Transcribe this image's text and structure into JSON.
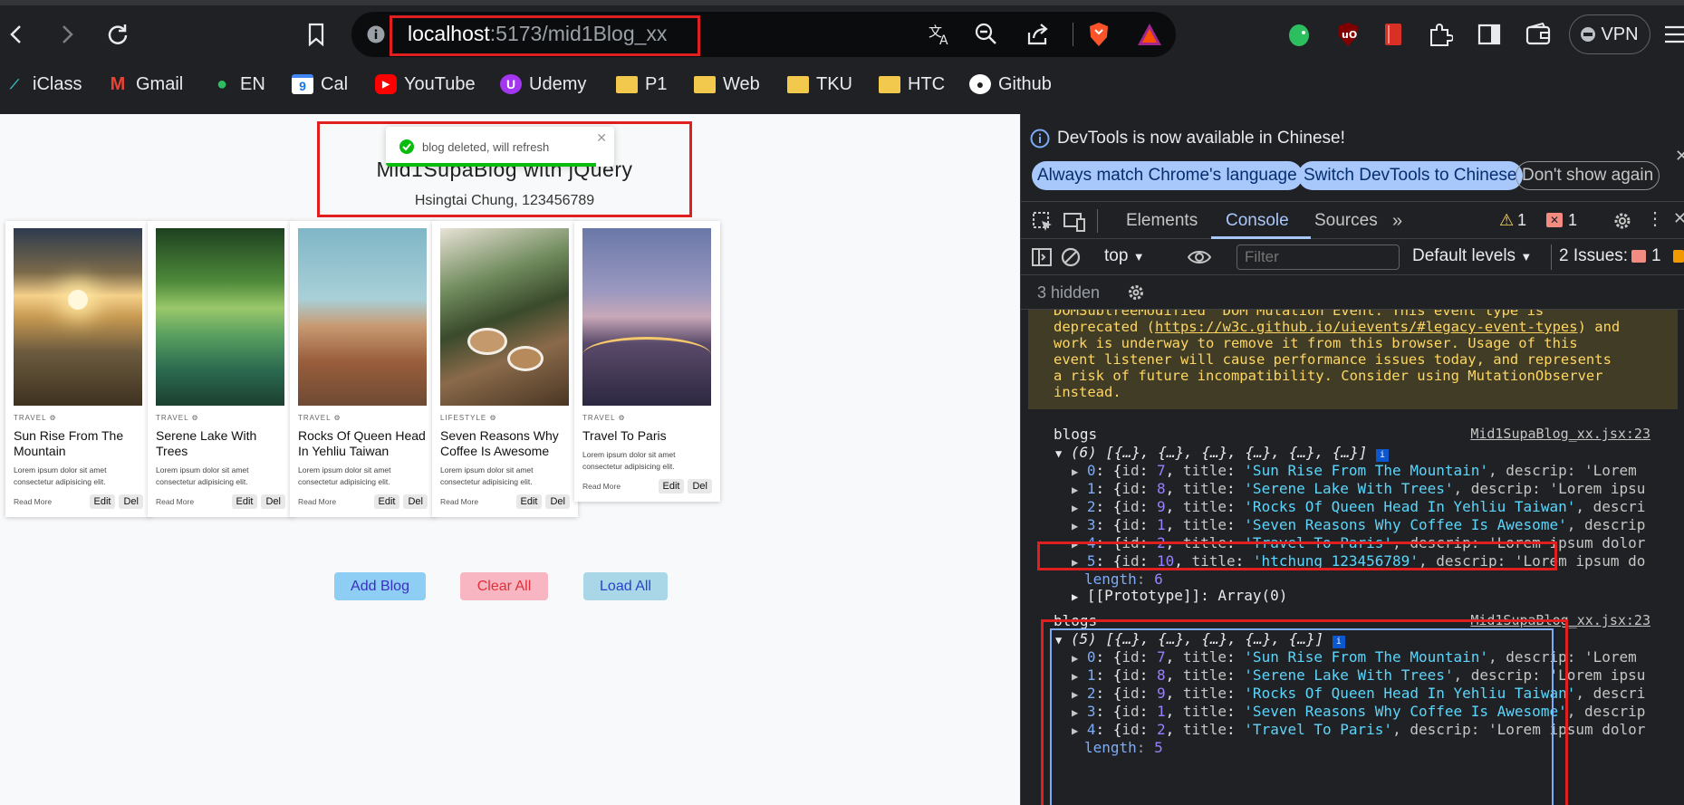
{
  "browser": {
    "url_host": "localhost",
    "url_path": ":5173/mid1Blog_xx",
    "vpn_label": "VPN",
    "bookmarks": [
      {
        "label": "iClass",
        "icon": "iclass-icon"
      },
      {
        "label": "Gmail",
        "icon": "gmail-icon"
      },
      {
        "label": "EN",
        "icon": "evernote-icon"
      },
      {
        "label": "Cal",
        "icon": "calendar-icon"
      },
      {
        "label": "YouTube",
        "icon": "youtube-icon"
      },
      {
        "label": "Udemy",
        "icon": "udemy-icon"
      },
      {
        "label": "P1",
        "icon": "folder-icon"
      },
      {
        "label": "Web",
        "icon": "folder-icon"
      },
      {
        "label": "TKU",
        "icon": "folder-icon"
      },
      {
        "label": "HTC",
        "icon": "folder-icon"
      },
      {
        "label": "Github",
        "icon": "github-icon"
      }
    ]
  },
  "app": {
    "title": "Mid1SupaBlog with jQuery",
    "subtitle": "Hsingtai Chung, 123456789",
    "toast": "blog deleted, will refresh",
    "cards": [
      {
        "category": "TRAVEL",
        "title": "Sun Rise From The Mountain",
        "desc": "Lorem ipsum dolor sit amet consectetur adipisicing elit.",
        "read_more": "Read More",
        "edit": "Edit",
        "del": "Del"
      },
      {
        "category": "TRAVEL",
        "title": "Serene Lake With Trees",
        "desc": "Lorem ipsum dolor sit amet consectetur adipisicing elit.",
        "read_more": "Read More",
        "edit": "Edit",
        "del": "Del"
      },
      {
        "category": "TRAVEL",
        "title": "Rocks Of Queen Head In Yehliu Taiwan",
        "desc": "Lorem ipsum dolor sit amet consectetur adipisicing elit.",
        "read_more": "Read More",
        "edit": "Edit",
        "del": "Del"
      },
      {
        "category": "LIFESTYLE",
        "title": "Seven Reasons Why Coffee Is Awesome",
        "desc": "Lorem ipsum dolor sit amet consectetur adipisicing elit.",
        "read_more": "Read More",
        "edit": "Edit",
        "del": "Del"
      },
      {
        "category": "TRAVEL",
        "title": "Travel To Paris",
        "desc": "Lorem ipsum dolor sit amet consectetur adipisicing elit.",
        "read_more": "Read More",
        "edit": "Edit",
        "del": "Del"
      }
    ],
    "buttons": {
      "add": "Add Blog",
      "clear": "Clear All",
      "load": "Load All"
    }
  },
  "devtools": {
    "info": "DevTools is now available in Chinese!",
    "lang_buttons": [
      "Always match Chrome's language",
      "Switch DevTools to Chinese",
      "Don't show again"
    ],
    "tabs": [
      "Elements",
      "Console",
      "Sources"
    ],
    "warn_count": "1",
    "error_count": "1",
    "context": "top",
    "filter_placeholder": "Filter",
    "levels": "Default levels",
    "issues": "2 Issues:",
    "issues_count": "1",
    "hidden": "3 hidden",
    "warning_lines": [
      "DOMSubtreeModified  DOM Mutation Event. This event type is",
      "deprecated (",
      "https://w3c.github.io/uievents/#legacy-event-types",
      ") and",
      "work is underway to remove it from this browser. Usage of this",
      "event listener will cause performance issues today, and represents",
      "a risk of future incompatibility. Consider using MutationObserver",
      "instead."
    ],
    "log_label": "blogs",
    "source": "Mid1SupaBlog_xx.jsx:23",
    "group1_header": "(6) [{…}, {…}, {…}, {…}, {…}, {…}]",
    "group2_header": "(5) [{…}, {…}, {…}, {…}, {…}]",
    "length_label": "length",
    "length6": "6",
    "length5": "5",
    "prototype": "[[Prototype]]: Array(0)",
    "group1": [
      {
        "idx": "0",
        "id": "7",
        "title": "'Sun Rise From The Mountain'",
        "tail": ", descrip: 'Lorem"
      },
      {
        "idx": "1",
        "id": "8",
        "title": "'Serene Lake With Trees'",
        "tail": ", descrip: 'Lorem ipsu"
      },
      {
        "idx": "2",
        "id": "9",
        "title": "'Rocks Of Queen Head In Yehliu Taiwan'",
        "tail": ", descri"
      },
      {
        "idx": "3",
        "id": "1",
        "title": "'Seven Reasons Why Coffee Is Awesome'",
        "tail": ", descrip"
      },
      {
        "idx": "4",
        "id": "2",
        "title": "'Travel To Paris'",
        "tail": ", descrip: 'Lorem ipsum dolor"
      },
      {
        "idx": "5",
        "id": "10",
        "title": "'htchung 123456789'",
        "tail": ", descrip: 'Lorem ipsum do"
      }
    ],
    "group2": [
      {
        "idx": "0",
        "id": "7",
        "title": "'Sun Rise From The Mountain'",
        "tail": ", descrip: 'Lorem"
      },
      {
        "idx": "1",
        "id": "8",
        "title": "'Serene Lake With Trees'",
        "tail": ", descrip: 'Lorem ipsu"
      },
      {
        "idx": "2",
        "id": "9",
        "title": "'Rocks Of Queen Head In Yehliu Taiwan'",
        "tail": ", descri"
      },
      {
        "idx": "3",
        "id": "1",
        "title": "'Seven Reasons Why Coffee Is Awesome'",
        "tail": ", descrip"
      },
      {
        "idx": "4",
        "id": "2",
        "title": "'Travel To Paris'",
        "tail": ", descrip: 'Lorem ipsum dolor"
      }
    ]
  }
}
